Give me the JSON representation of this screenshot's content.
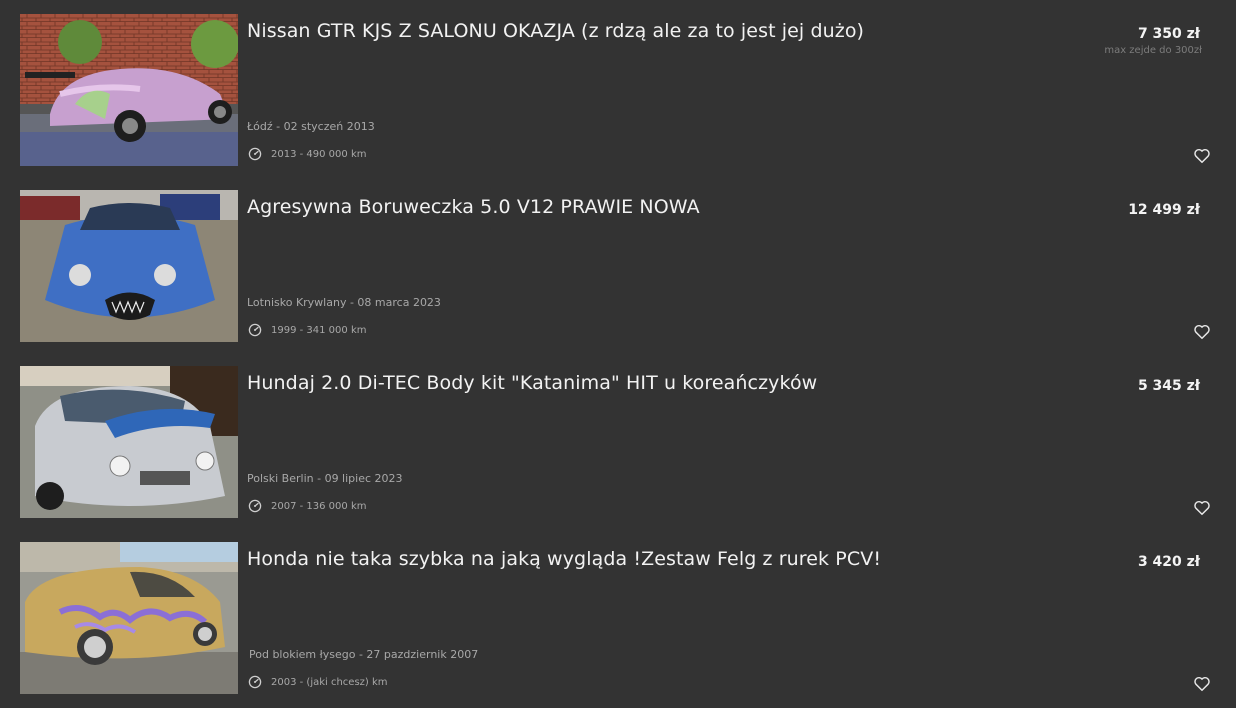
{
  "listings": [
    {
      "title": "Nissan GTR KJS Z SALONU OKAZJA (z rdzą ale za to jest jej dużo)",
      "price": "7 350 zł",
      "price_note": "max zejde do 300zł",
      "location": "Łódź - 02 styczeń 2013",
      "specs": "2013 - 490 000 km",
      "image_icon": "car-photo-pink-coupe"
    },
    {
      "title": "Agresywna Boruweczka 5.0 V12 PRAWIE NOWA",
      "price": "12 499 zł",
      "price_note": "",
      "location": "Lotnisko Krywlany - 08 marca 2023",
      "specs": "1999 - 341 000 km",
      "image_icon": "car-photo-blue-hatchback"
    },
    {
      "title": "Hundaj 2.0 Di-TEC Body kit \"Katanima\" HIT u koreańczyków",
      "price": "5 345 zł",
      "price_note": "",
      "location": "Polski Berlin - 09 lipiec 2023",
      "specs": "2007 - 136 000 km",
      "image_icon": "car-photo-silver-sedan"
    },
    {
      "title": "Honda nie taka szybka na jaką wygląda !Zestaw Felg z rurek PCV!",
      "price": "3 420 zł",
      "price_note": "",
      "location": "Pod blokiem łysego - 27 pazdziernik 2007",
      "specs": "2003 - (jaki chcesz) km",
      "image_icon": "car-photo-gold-sedan"
    }
  ],
  "colors": {
    "background": "#333333",
    "title": "#f2f2f2",
    "meta": "#a8a8a8",
    "price_note": "#7c7c7c"
  }
}
